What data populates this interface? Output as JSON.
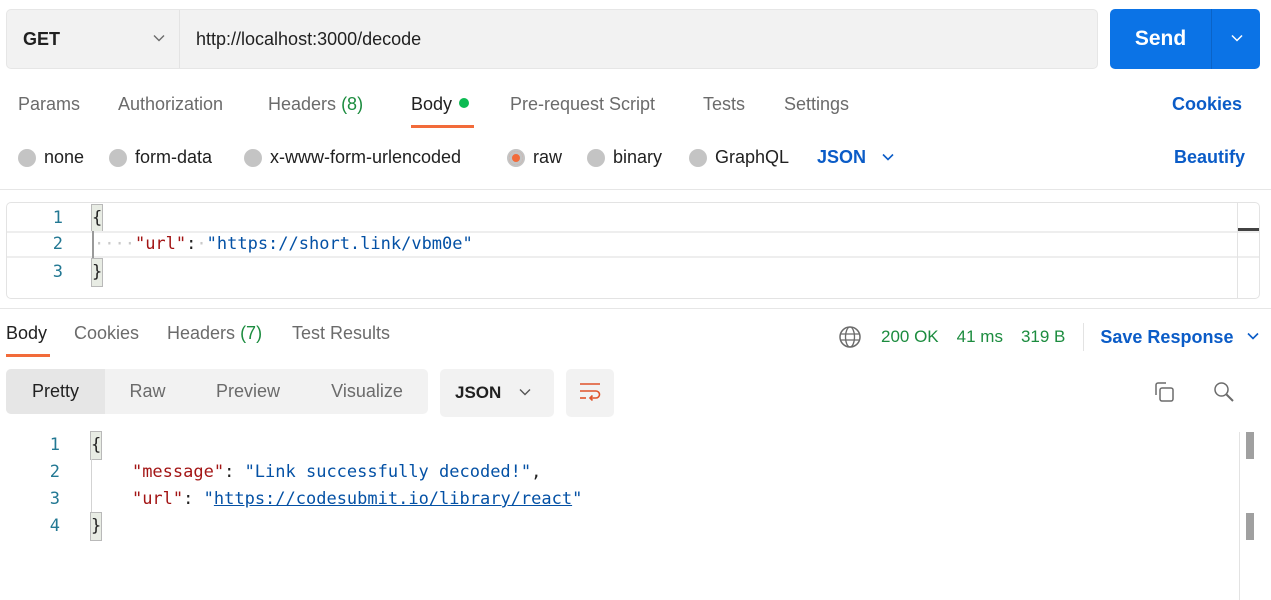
{
  "request": {
    "method": "GET",
    "url": "http://localhost:3000/decode",
    "send_label": "Send"
  },
  "request_tabs": [
    {
      "label": "Params"
    },
    {
      "label": "Authorization"
    },
    {
      "label": "Headers",
      "count": "(8)"
    },
    {
      "label": "Body",
      "active": true,
      "indicator": "green-dot"
    },
    {
      "label": "Pre-request Script"
    },
    {
      "label": "Tests"
    },
    {
      "label": "Settings"
    }
  ],
  "cookies_link": "Cookies",
  "body_types": [
    {
      "label": "none",
      "selected": false
    },
    {
      "label": "form-data",
      "selected": false
    },
    {
      "label": "x-www-form-urlencoded",
      "selected": false
    },
    {
      "label": "raw",
      "selected": true
    },
    {
      "label": "binary",
      "selected": false
    },
    {
      "label": "GraphQL",
      "selected": false
    }
  ],
  "raw_format": "JSON",
  "beautify_label": "Beautify",
  "request_body": {
    "lines": [
      {
        "n": "1",
        "text": "{"
      },
      {
        "n": "2",
        "key": "\"url\"",
        "sep": ": ",
        "value": "\"https://short.link/vbm0e\""
      },
      {
        "n": "3",
        "text": "}"
      }
    ]
  },
  "response_tabs": [
    {
      "label": "Body",
      "active": true
    },
    {
      "label": "Cookies"
    },
    {
      "label": "Headers",
      "count": "(7)"
    },
    {
      "label": "Test Results"
    }
  ],
  "response_status": {
    "status": "200 OK",
    "time": "41 ms",
    "size": "319 B",
    "save_label": "Save Response"
  },
  "view_modes": [
    {
      "label": "Pretty",
      "active": true
    },
    {
      "label": "Raw"
    },
    {
      "label": "Preview"
    },
    {
      "label": "Visualize"
    }
  ],
  "response_format": "JSON",
  "icons": {
    "wrap": "wrap-lines-icon",
    "copy": "copy-icon",
    "search": "search-icon",
    "globe": "globe-icon"
  },
  "response_body": {
    "lines": [
      {
        "n": "1",
        "text": "{"
      },
      {
        "n": "2",
        "key": "\"message\"",
        "sep": ": ",
        "value": "\"Link successfully decoded!\"",
        "trail": ","
      },
      {
        "n": "3",
        "key": "\"url\"",
        "sep": ": ",
        "quote": "\"",
        "link": "https://codesubmit.io/library/react"
      },
      {
        "n": "4",
        "text": "}"
      }
    ]
  },
  "colors": {
    "accent_blue": "#0b73e6",
    "link_blue": "#0b5cc7",
    "active_orange": "#f26b3a",
    "status_green": "#1c8c3f"
  }
}
